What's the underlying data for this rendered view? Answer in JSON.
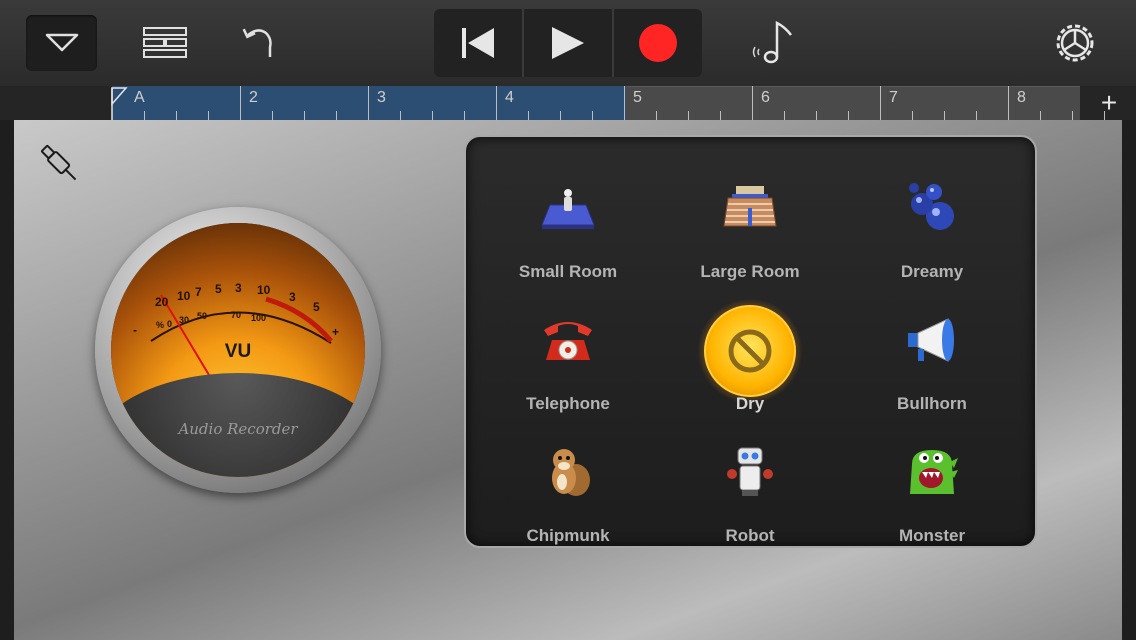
{
  "toolbar": {
    "browser_icon": "chevron-down-icon",
    "tracks_icon": "tracks-view-icon",
    "undo_icon": "undo-icon",
    "rewind_icon": "go-to-beginning-icon",
    "play_icon": "play-icon",
    "record_icon": "record-icon",
    "record_color": "#ff2525",
    "smart_controls_icon": "music-note-icon",
    "settings_icon": "gear-icon"
  },
  "ruler": {
    "bars": [
      "A",
      "2",
      "3",
      "4",
      "5",
      "6",
      "7",
      "8"
    ],
    "region_color": "#2c4e72",
    "add_label": "+"
  },
  "vu_meter": {
    "title": "VU",
    "brand": "Audio Recorder",
    "scale_top": [
      "20",
      "10",
      "7",
      "5",
      "3",
      "10",
      "3",
      "5"
    ],
    "scale_bottom": [
      "0",
      "30",
      "50",
      "70",
      "100"
    ],
    "minus": "-",
    "plus": "+",
    "percent": "%"
  },
  "effects": [
    {
      "label": "Small Room",
      "icon": "small-room-icon"
    },
    {
      "label": "Large Room",
      "icon": "large-room-icon"
    },
    {
      "label": "Dreamy",
      "icon": "bubbles-icon"
    },
    {
      "label": "Telephone",
      "icon": "telephone-icon"
    },
    {
      "label": "Dry",
      "icon": "no-effect-icon",
      "selected": true
    },
    {
      "label": "Bullhorn",
      "icon": "megaphone-icon"
    },
    {
      "label": "Chipmunk",
      "icon": "chipmunk-icon"
    },
    {
      "label": "Robot",
      "icon": "robot-icon"
    },
    {
      "label": "Monster",
      "icon": "monster-icon"
    }
  ],
  "accent_selected": "#ffb400"
}
